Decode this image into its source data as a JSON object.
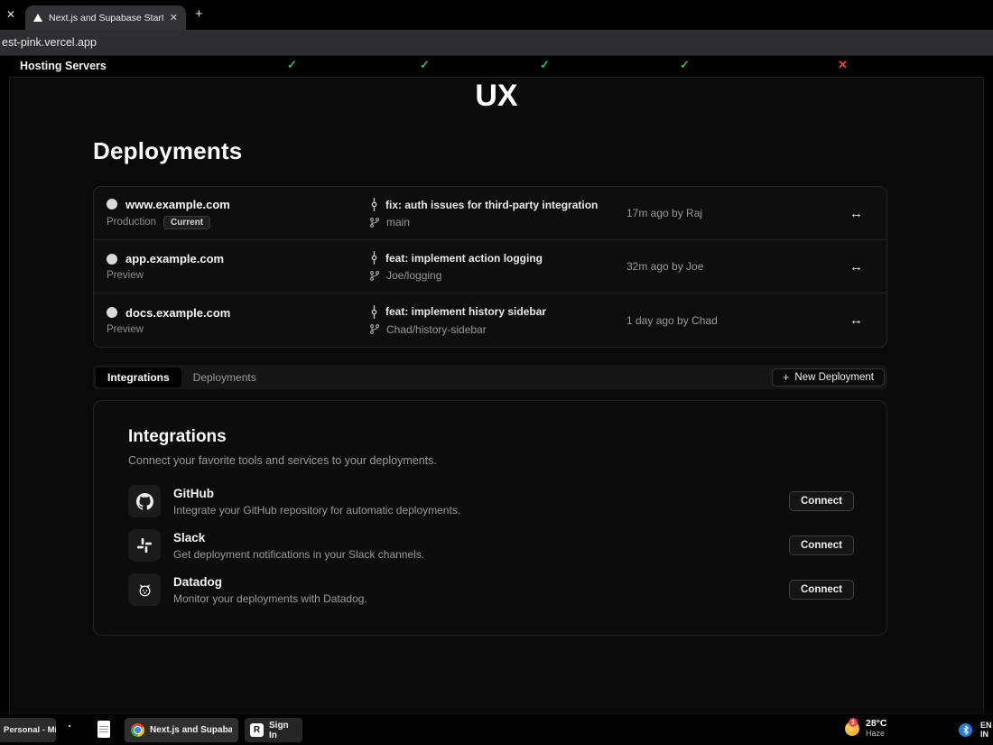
{
  "browser": {
    "tab": {
      "title": "Next.js and Supabase Starter Ki"
    },
    "url": "est-pink.vercel.app"
  },
  "icons": {
    "close": "✕",
    "plus": "+",
    "swap_arrow": "↔"
  },
  "comparison": {
    "row_label": "Hosting Servers",
    "marks": [
      "✓",
      "✓",
      "✓",
      "✓",
      "✕"
    ],
    "check_color": "#2fbf4f",
    "cross_color": "#e5484d"
  },
  "hero": "UX",
  "deployments": {
    "title": "Deployments",
    "rows": [
      {
        "domain": "www.example.com",
        "environment": "Production",
        "badge": "Current",
        "commit_message": "fix: auth issues for third-party integration",
        "branch": "main",
        "meta": "17m ago by Raj"
      },
      {
        "domain": "app.example.com",
        "environment": "Preview",
        "commit_message": "feat: implement action logging",
        "branch": "Joe/logging",
        "meta": "32m ago by Joe"
      },
      {
        "domain": "docs.example.com",
        "environment": "Preview",
        "commit_message": "feat: implement history sidebar",
        "branch": "Chad/history-sidebar",
        "meta": "1 day ago by Chad"
      }
    ]
  },
  "tabs": {
    "integrations_label": "Integrations",
    "deployments_label": "Deployments",
    "new_deployment_label": "New Deployment"
  },
  "integrations": {
    "title": "Integrations",
    "subtitle": "Connect your favorite tools and services to your deployments.",
    "items": [
      {
        "name": "GitHub",
        "description": "Integrate your GitHub repository for automatic deployments.",
        "action_label": "Connect"
      },
      {
        "name": "Slack",
        "description": "Get deployment notifications in your Slack channels.",
        "action_label": "Connect"
      },
      {
        "name": "Datadog",
        "description": "Monitor your deployments with Datadog.",
        "action_label": "Connect"
      }
    ]
  },
  "taskbar": {
    "profile_label": "Personal - Mi",
    "active_window_label": "Next.js and Supabase St",
    "r_app_letter": "R",
    "sign_in_label": "Sign In",
    "weather": {
      "temperature": "28°C",
      "condition": "Haze",
      "notification_count": "1"
    },
    "language": {
      "line1": "EN",
      "line2": "IN"
    }
  },
  "colors": {
    "page_bg": "#0a0a0a",
    "card_bg": "#0d0d0d",
    "check_green": "#2fbf4f",
    "cross_red": "#e5484d"
  }
}
